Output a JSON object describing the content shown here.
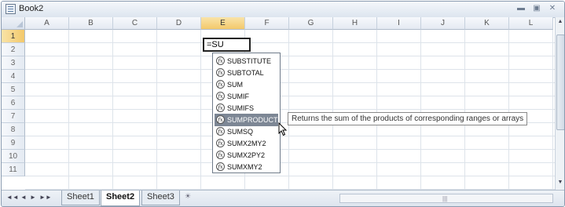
{
  "window": {
    "title": "Book2"
  },
  "columns": [
    "A",
    "B",
    "C",
    "D",
    "E",
    "F",
    "G",
    "H",
    "I",
    "J",
    "K",
    "L"
  ],
  "active_column": "E",
  "rows": [
    "1",
    "2",
    "3",
    "4",
    "5",
    "6",
    "7",
    "8",
    "9",
    "10",
    "11"
  ],
  "active_row": "1",
  "active_cell": {
    "value": "=SU"
  },
  "autocomplete": {
    "items": [
      "SUBSTITUTE",
      "SUBTOTAL",
      "SUM",
      "SUMIF",
      "SUMIFS",
      "SUMPRODUCT",
      "SUMSQ",
      "SUMX2MY2",
      "SUMX2PY2",
      "SUMXMY2"
    ],
    "selected": "SUMPRODUCT",
    "icon": "function-fx-icon",
    "icon_text": "fx",
    "tooltip": "Returns the sum of the products of corresponding ranges or arrays"
  },
  "sheets": {
    "tabs": [
      "Sheet1",
      "Sheet2",
      "Sheet3"
    ],
    "active": "Sheet2"
  },
  "colors": {
    "header_active": "#f3c96b",
    "selection": "#7d8795"
  }
}
